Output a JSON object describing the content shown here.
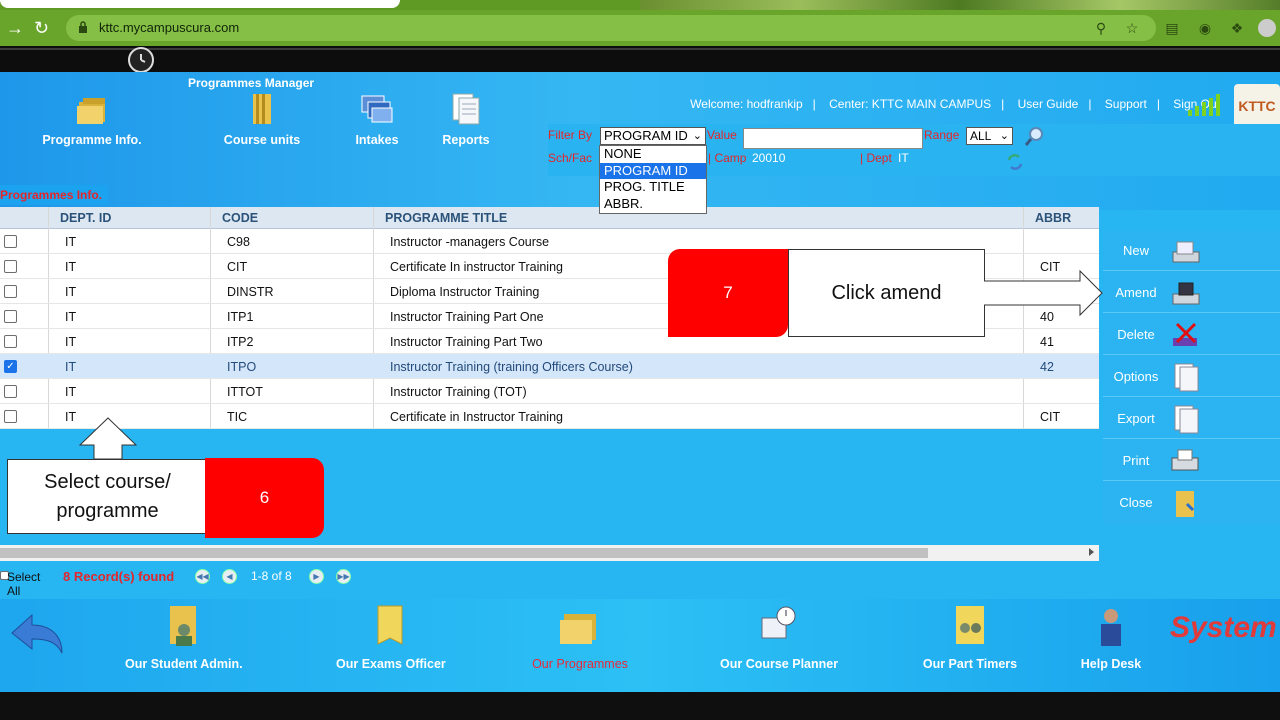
{
  "browser": {
    "url": "kttc.mycampuscura.com"
  },
  "header": {
    "title": "Programmes Manager",
    "tools": [
      {
        "label": "Programme Info."
      },
      {
        "label": "Course units"
      },
      {
        "label": "Intakes"
      },
      {
        "label": "Reports"
      }
    ],
    "nav": {
      "welcome": "Welcome: hodfrankip",
      "center": "Center: KTTC MAIN CAMPUS",
      "user_guide": "User Guide",
      "support": "Support",
      "sign_out": "Sign Out"
    },
    "logo_text": "KTTC"
  },
  "filter": {
    "filter_by_label": "Filter By",
    "selected": "PROGRAM ID",
    "options": [
      "NONE",
      "PROGRAM ID",
      "PROG. TITLE",
      "ABBR."
    ],
    "value_label": "Value",
    "value": "",
    "range_label": "Range",
    "range_value": "ALL",
    "sch_fac_label": "Sch/Fac",
    "camp_label": "| Camp",
    "camp_value": "20010",
    "dept_label": "| Dept",
    "dept_value": "IT"
  },
  "section": {
    "tab": "Programmes Info."
  },
  "table": {
    "columns": [
      "DEPT. ID",
      "CODE",
      "PROGRAMME TITLE",
      "ABBR"
    ],
    "rows": [
      {
        "dept": "IT",
        "code": "C98",
        "title": "Instructor -managers Course",
        "abbr": "",
        "checked": false
      },
      {
        "dept": "IT",
        "code": "CIT",
        "title": "Certificate In instructor Training",
        "abbr": "CIT",
        "checked": false
      },
      {
        "dept": "IT",
        "code": "DINSTR",
        "title": "Diploma Instructor Training",
        "abbr": "",
        "checked": false
      },
      {
        "dept": "IT",
        "code": "ITP1",
        "title": "Instructor Training Part One",
        "abbr": "40",
        "checked": false
      },
      {
        "dept": "IT",
        "code": "ITP2",
        "title": "Instructor Training Part Two",
        "abbr": "41",
        "checked": false
      },
      {
        "dept": "IT",
        "code": "ITPO",
        "title": "Instructor Training (training Officers Course)",
        "abbr": "42",
        "checked": true
      },
      {
        "dept": "IT",
        "code": "ITTOT",
        "title": "Instructor Training (TOT)",
        "abbr": "",
        "checked": false
      },
      {
        "dept": "IT",
        "code": "TIC",
        "title": "Certificate in Instructor Training",
        "abbr": "CIT",
        "checked": false
      }
    ]
  },
  "actions": [
    {
      "label": "New"
    },
    {
      "label": "Amend"
    },
    {
      "label": "Delete"
    },
    {
      "label": "Options"
    },
    {
      "label": "Export"
    },
    {
      "label": "Print"
    },
    {
      "label": "Close"
    }
  ],
  "annotations": {
    "step7_number": "7",
    "step7_text": "Click amend",
    "step6_number": "6",
    "step6_text": "Select course/ programme"
  },
  "pager": {
    "select_all": "Select All",
    "records_found": "8 Record(s) found",
    "range": "1-8 of 8"
  },
  "bottom_nav": [
    {
      "label": "Our Student Admin."
    },
    {
      "label": "Our Exams Officer"
    },
    {
      "label": "Our Programmes"
    },
    {
      "label": "Our Course Planner"
    },
    {
      "label": "Our Part Timers"
    },
    {
      "label": "Help Desk"
    }
  ],
  "bottom_logo": "System",
  "colors": {
    "app_bg": "#27b6f2",
    "accent_red": "#e4262a",
    "annotation_red": "#ff0000",
    "browser_green": "#6aa52b"
  }
}
